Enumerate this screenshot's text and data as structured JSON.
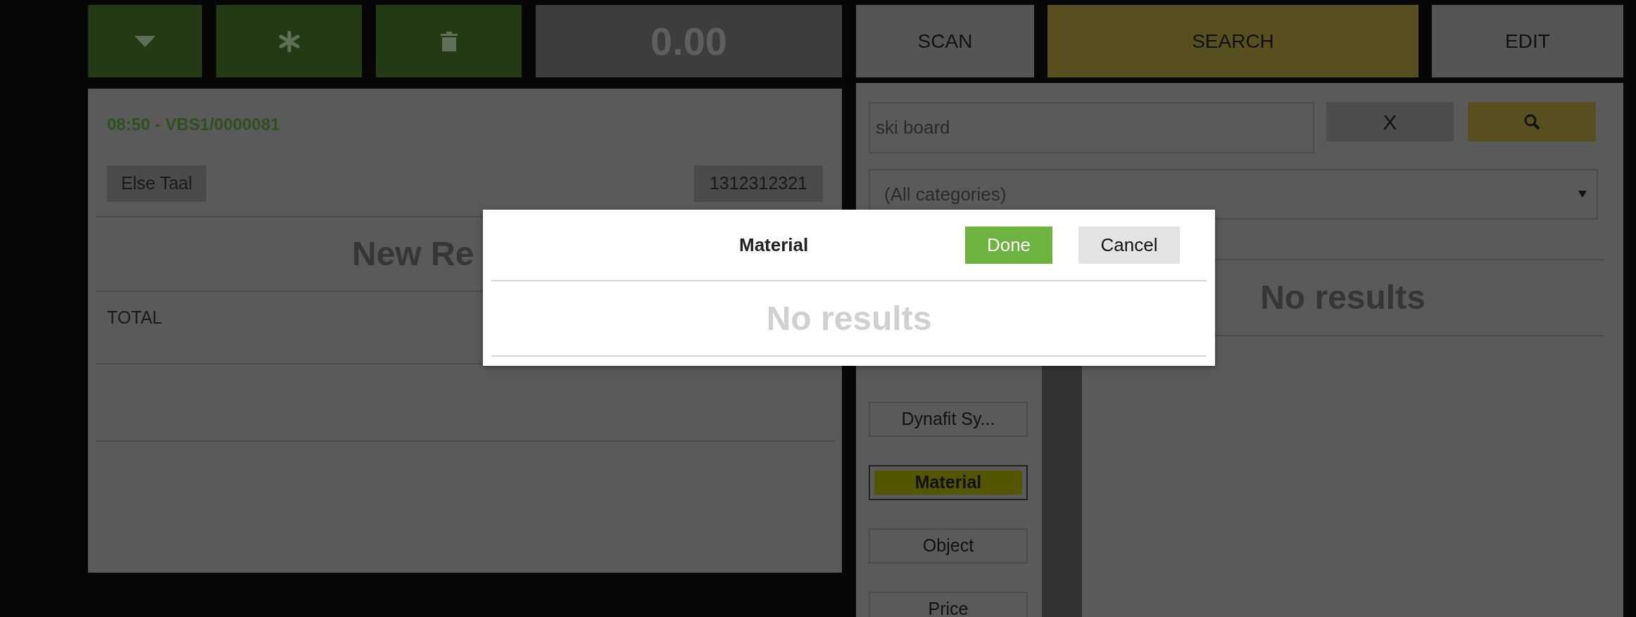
{
  "toolbar": {
    "buttons": [
      {
        "kind": "dropdown"
      },
      {
        "kind": "asterisk"
      },
      {
        "kind": "trash"
      }
    ],
    "total": "0.00"
  },
  "receipt": {
    "title": "08:50 - VBS1/0000081",
    "customer": "Else Taal",
    "number": "1312312321",
    "heading": "New Re",
    "total_label": "TOTAL"
  },
  "tabs": [
    {
      "label": "SCAN",
      "selected": false
    },
    {
      "label": "SEARCH",
      "selected": true
    },
    {
      "label": "EDIT",
      "selected": false
    }
  ],
  "search": {
    "value": "ski board",
    "clear_label": "X"
  },
  "category_select": {
    "value": "(All categories)"
  },
  "categories": [
    {
      "label": "Dynafit Sy...",
      "selected": false
    },
    {
      "label": "Material",
      "selected": true
    },
    {
      "label": "Object",
      "selected": false
    },
    {
      "label": "Price",
      "selected": false
    }
  ],
  "results_message": "No results",
  "dialog": {
    "title": "Material",
    "buttons": [
      {
        "label": "Done",
        "kind": "primary"
      },
      {
        "label": "Cancel",
        "kind": "secondary"
      }
    ],
    "message": "No results"
  }
}
